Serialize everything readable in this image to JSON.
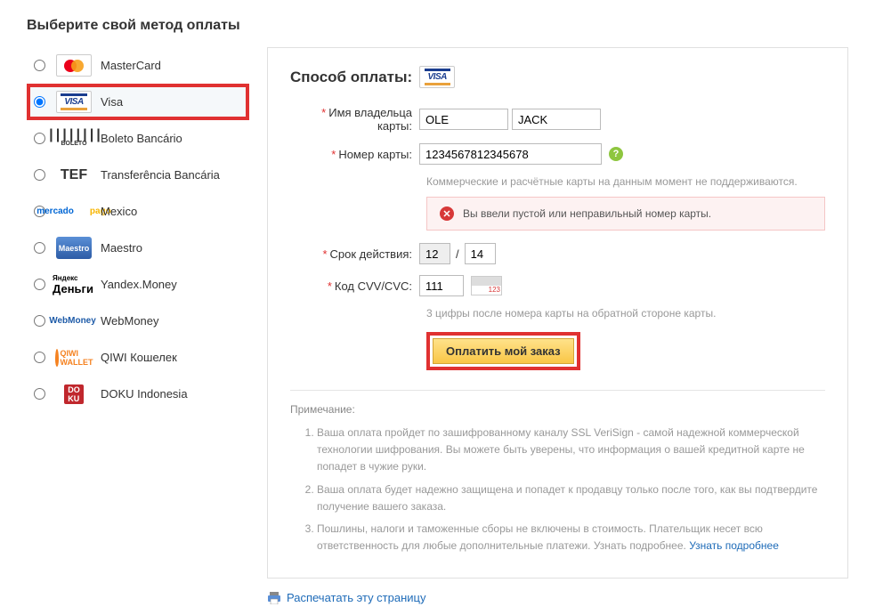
{
  "title": "Выберите свой метод оплаты",
  "methods": [
    {
      "key": "mastercard",
      "label": "MasterCard",
      "selected": false
    },
    {
      "key": "visa",
      "label": "Visa",
      "selected": true
    },
    {
      "key": "boleto",
      "label": "Boleto Bancário",
      "selected": false
    },
    {
      "key": "tef",
      "label": "Transferência Bancária",
      "selected": false
    },
    {
      "key": "mercadopago",
      "label": "Mexico",
      "selected": false
    },
    {
      "key": "maestro",
      "label": "Maestro",
      "selected": false
    },
    {
      "key": "yandex",
      "label": "Yandex.Money",
      "selected": false
    },
    {
      "key": "webmoney",
      "label": "WebMoney",
      "selected": false
    },
    {
      "key": "qiwi",
      "label": "QIWI Кошелек",
      "selected": false
    },
    {
      "key": "doku",
      "label": "DOKU Indonesia",
      "selected": false
    }
  ],
  "panel": {
    "title": "Способ оплаты:",
    "name_label": "Имя владельца карты:",
    "first_name": "OLE",
    "last_name": "JACK",
    "cardnum_label": "Номер карты:",
    "cardnum_value": "1234567812345678",
    "cardnum_hint": "Коммерческие и расчётные карты на данным момент не поддерживаются.",
    "error_msg": "Вы ввели пустой или неправильный номер карты.",
    "expiry_label": "Срок действия:",
    "expiry_month": "12",
    "expiry_year": "14",
    "cvv_label": "Код CVV/CVC:",
    "cvv_value": "111",
    "cvv_img_text": "123",
    "cvv_hint": "3 цифры после номера карты на обратной стороне карты.",
    "submit_label": "Оплатить мой заказ"
  },
  "notes": {
    "title": "Примечание:",
    "items": [
      "Ваша оплата пройдет по зашифрованному каналу SSL VeriSign - самой надежной коммерческой технологии шифрования. Вы можете быть уверены, что информация о вашей кредитной карте не попадет в чужие руки.",
      "Ваша оплата будет надежно защищена и попадет к продавцу только после того, как вы подтвердите получение вашего заказа.",
      "Пошлины, налоги и таможенные сборы не включены в стоимость. Плательщик несет всю ответственность для любые дополнительные платежи. Узнать подробнее."
    ],
    "more_link": "Узнать подробнее"
  },
  "print": "Распечатать эту страницу"
}
